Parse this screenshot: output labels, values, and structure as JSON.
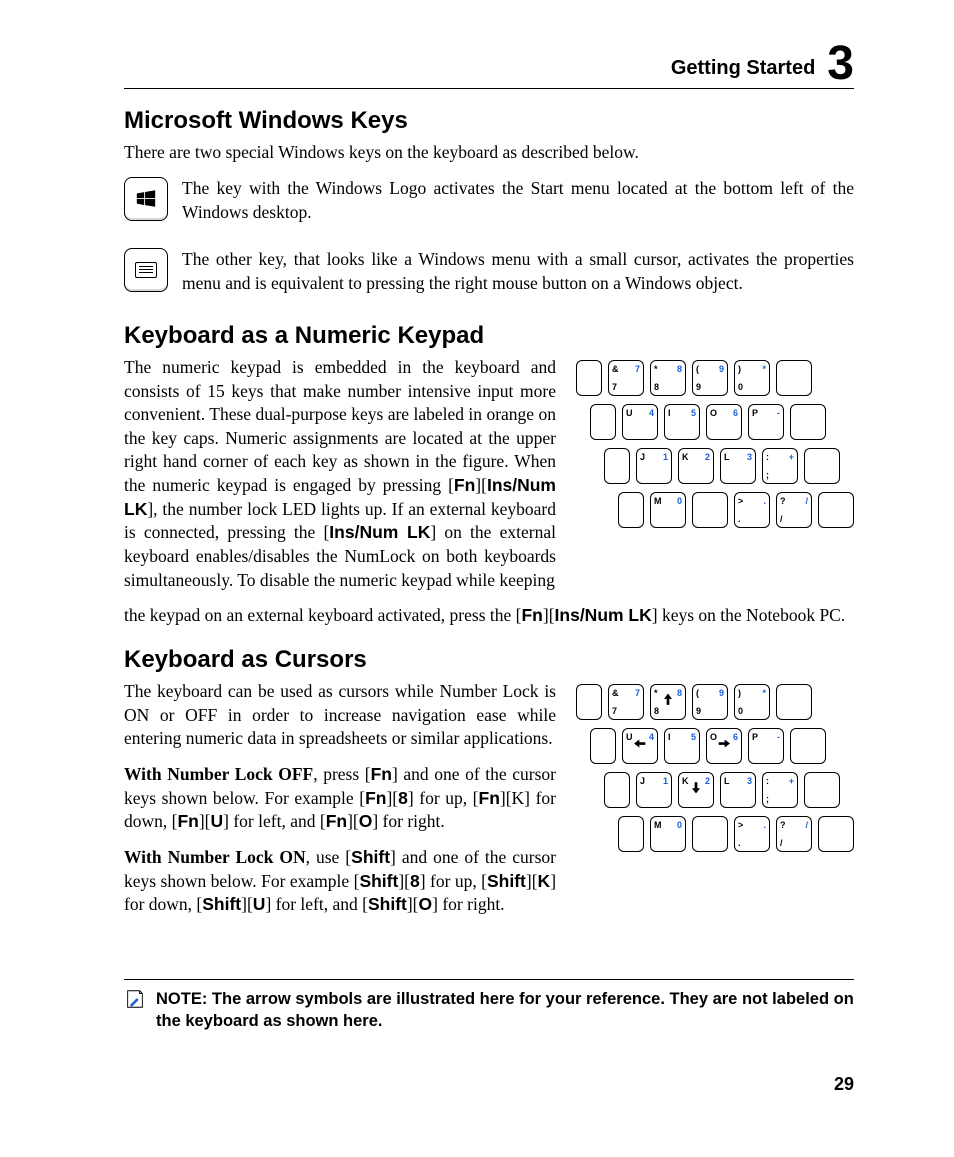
{
  "header": {
    "title": "Getting Started",
    "chapter": "3"
  },
  "sec1": {
    "heading": "Microsoft Windows Keys",
    "intro": "There are two special Windows keys on the keyboard as described below.",
    "item1": "The key with the Windows Logo activates the Start menu located at the bottom left of the Windows desktop.",
    "item2": "The other key, that looks like a Windows menu with a small cursor, activates the properties menu and is equivalent to pressing the right mouse button on a Windows object."
  },
  "sec2": {
    "heading": "Keyboard as a Numeric Keypad",
    "body_segments": [
      "The numeric keypad is embedded in the keyboard and consists of 15 keys that make number intensive input more convenient. These dual-purpose keys are labeled in orange on the key caps. Numeric assignments are located at the upper right hand corner of each key as shown in the figure. When the numeric keypad is engaged by pressing [",
      "Fn",
      "][",
      "Ins/Num LK",
      "], the number lock LED lights up. If an external keyboard is connected, pressing the [",
      "Ins/Num LK",
      "] on the external keyboard enables/disables the NumLock on both keyboards simultaneously. To disable the numeric keypad while keeping"
    ],
    "tail_segments": [
      "the keypad on an external keyboard activated, press the  [",
      "Fn",
      "][",
      "Ins/Num LK",
      "] keys on the Notebook PC."
    ]
  },
  "sec3": {
    "heading": "Keyboard as Cursors",
    "p1": "The keyboard can be used as cursors while Number Lock is ON or OFF in order to increase navigation ease while entering numeric data in spreadsheets or similar applications.",
    "p2_segments": [
      "With Number Lock OFF",
      ", press [",
      "Fn",
      "] and one of the cursor keys shown below. For example [",
      "Fn",
      "][",
      "8",
      "] for up, [",
      "Fn",
      "][K] for down, [",
      "Fn",
      "][",
      "U",
      "] for left, and [",
      "Fn",
      "][",
      "O",
      "] for right."
    ],
    "p3_segments": [
      "With Number Lock ON",
      ", use [",
      "Shift",
      "] and one of the cursor keys shown below. For example [",
      "Shift",
      "][",
      "8",
      "] for up, [",
      "Shift",
      "][",
      "K",
      "] for down, [",
      "Shift",
      "][",
      "U",
      "] for left, and [",
      "Shift",
      "][",
      "O",
      "] for right."
    ]
  },
  "note": "NOTE: The arrow symbols are illustrated here for your reference. They are not labeled on the keyboard as shown here.",
  "page_number": "29",
  "fig_numpad": {
    "r1": [
      null,
      {
        "tl": "&",
        "tr": "7",
        "bl": "7"
      },
      {
        "tl": "*",
        "tr": "8",
        "bl": "8"
      },
      {
        "tl": "(",
        "tr": "9",
        "bl": "9"
      },
      {
        "tl": ")",
        "tr": "*",
        "bl": "0"
      },
      null
    ],
    "r2": [
      null,
      {
        "tl": "U",
        "tr": "4"
      },
      {
        "tl": "I",
        "tr": "5"
      },
      {
        "tl": "O",
        "tr": "6"
      },
      {
        "tl": "P",
        "tr": "-"
      },
      null
    ],
    "r3": [
      null,
      {
        "tl": "J",
        "tr": "1"
      },
      {
        "tl": "K",
        "tr": "2"
      },
      {
        "tl": "L",
        "tr": "3"
      },
      {
        "tl": ":",
        "tr": "+",
        "bl": ";"
      },
      null
    ],
    "r4": [
      null,
      {
        "tl": "M",
        "tr": "0"
      },
      null,
      {
        "tl": ">",
        "tr": ".",
        "bl": "."
      },
      {
        "tl": "?",
        "tr": "/",
        "bl": "/"
      },
      null
    ]
  },
  "fig_cursors": {
    "r1": [
      null,
      {
        "tl": "&",
        "tr": "7",
        "bl": "7"
      },
      {
        "tl": "*",
        "tr": "8",
        "bl": "8",
        "arrow": "up"
      },
      {
        "tl": "(",
        "tr": "9",
        "bl": "9"
      },
      {
        "tl": ")",
        "tr": "*",
        "bl": "0"
      },
      null
    ],
    "r2": [
      null,
      {
        "tl": "U",
        "tr": "4",
        "arrow": "left"
      },
      {
        "tl": "I",
        "tr": "5"
      },
      {
        "tl": "O",
        "tr": "6",
        "arrow": "right"
      },
      {
        "tl": "P",
        "tr": "-"
      },
      null
    ],
    "r3": [
      null,
      {
        "tl": "J",
        "tr": "1"
      },
      {
        "tl": "K",
        "tr": "2",
        "arrow": "down"
      },
      {
        "tl": "L",
        "tr": "3"
      },
      {
        "tl": ":",
        "tr": "+",
        "bl": ";"
      },
      null
    ],
    "r4": [
      null,
      {
        "tl": "M",
        "tr": "0"
      },
      null,
      {
        "tl": ">",
        "tr": ".",
        "bl": "."
      },
      {
        "tl": "?",
        "tr": "/",
        "bl": "/"
      },
      null
    ]
  }
}
